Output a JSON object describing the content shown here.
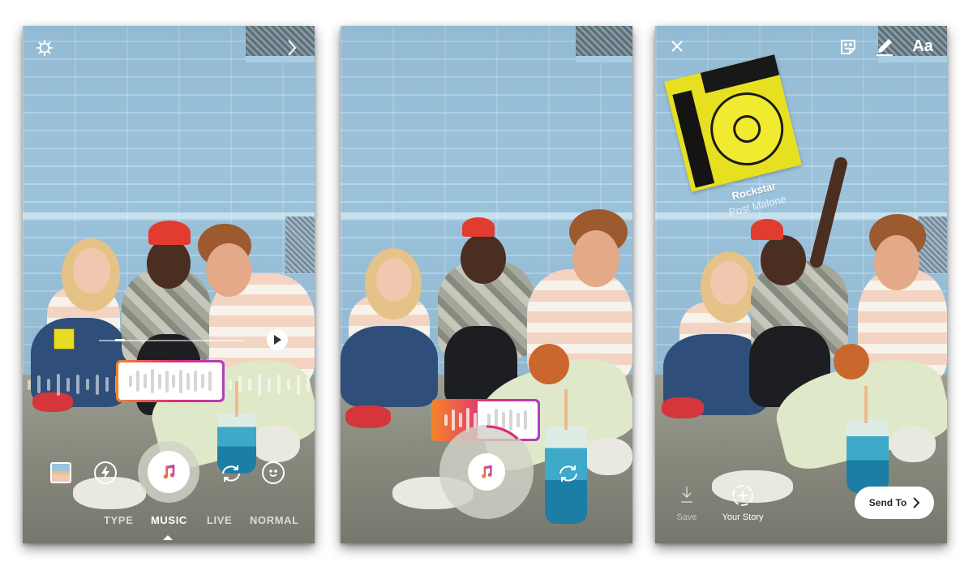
{
  "screens": [
    {
      "id": "camera-music-mode",
      "top_bar": {
        "left_icon": "gear-icon",
        "right_icon": "chevron-right-icon"
      },
      "music_scrubber": {
        "state": "unselected",
        "progress": 0.0,
        "bar_count": 12
      },
      "track_position": {
        "progress": 0.12,
        "play_icon": "play-icon"
      },
      "controls": {
        "gallery_icon": "gallery-thumbnail",
        "flash_icon": "flash-icon",
        "shutter_icon": "music-note-icon",
        "flip_icon": "flip-camera-icon",
        "effects_icon": "face-effects-icon"
      },
      "modes": [
        {
          "label": "TYPE",
          "active": false
        },
        {
          "label": "MUSIC",
          "active": true
        },
        {
          "label": "LIVE",
          "active": false
        },
        {
          "label": "NORMAL",
          "active": false
        }
      ]
    },
    {
      "id": "recording-with-music",
      "music_scrubber": {
        "state": "playing",
        "progress": 0.42,
        "bar_count": 12
      },
      "recording_progress": 0.12,
      "controls": {
        "shutter_icon": "music-note-icon",
        "flip_icon": "flip-camera-icon"
      }
    },
    {
      "id": "edit-story-with-sticker",
      "top_bar": {
        "close_icon": "close-icon",
        "sticker_icon": "sticker-icon",
        "draw_icon": "pen-icon",
        "text_tool_label": "Aa"
      },
      "music_sticker": {
        "song_title": "Rockstar",
        "artist": "Post Malone",
        "album_color": "#e6e021"
      },
      "bottom_bar": {
        "save_label": "Save",
        "your_story_label": "Your Story",
        "send_to_label": "Send To"
      }
    }
  ],
  "colors": {
    "gradient_start": "#f58529",
    "gradient_mid": "#dd2a7b",
    "gradient_end": "#b13fc2",
    "wall_blue": "#9cc3dc"
  }
}
